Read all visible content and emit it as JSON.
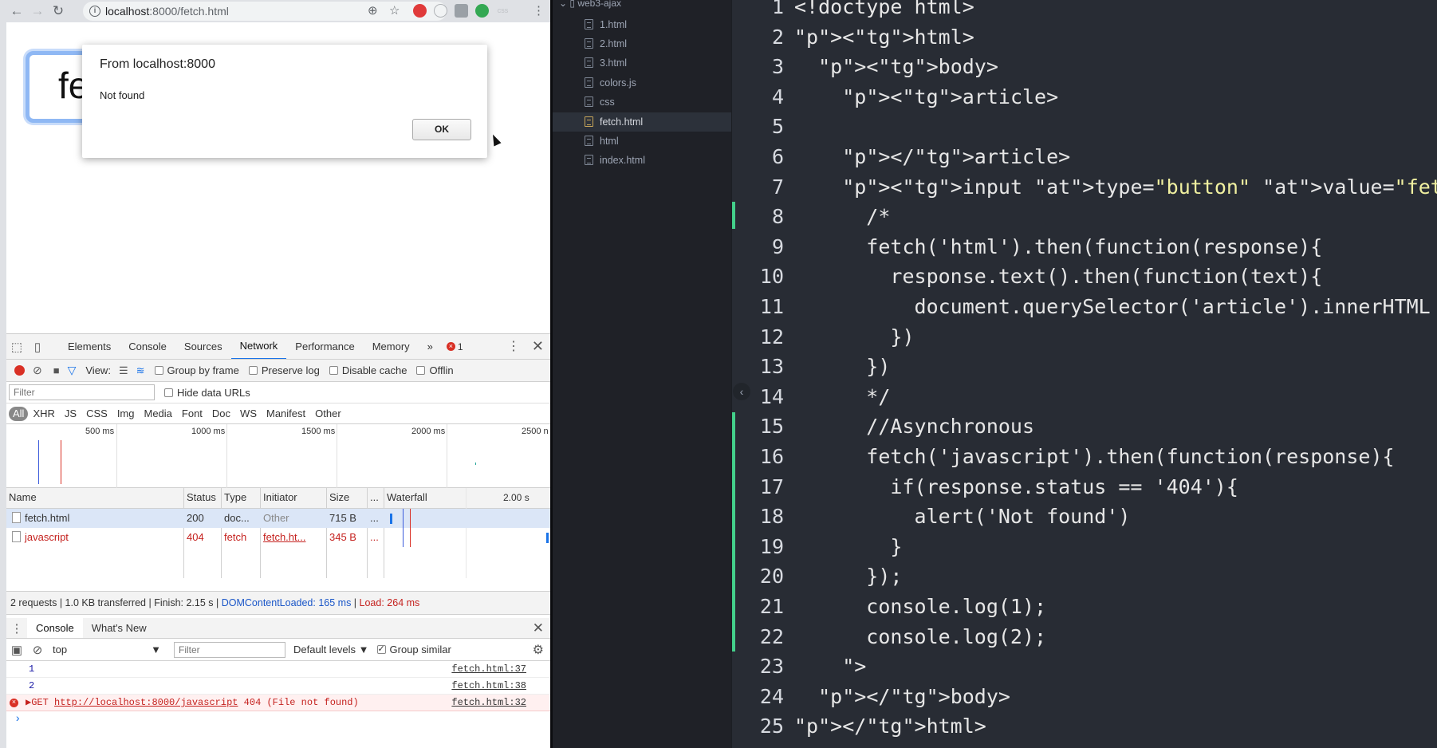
{
  "browser": {
    "url_host": "localhost",
    "url_path": ":8000/fetch.html",
    "page_button_text": "fe"
  },
  "alert": {
    "title": "From localhost:8000",
    "message": "Not found",
    "ok_label": "OK"
  },
  "devtools": {
    "tabs": [
      "Elements",
      "Console",
      "Sources",
      "Network",
      "Performance",
      "Memory"
    ],
    "active_tab": "Network",
    "overflow_label": "»",
    "error_count": "1",
    "net_toolbar": {
      "view_label": "View:",
      "group_by_frame": "Group by frame",
      "preserve_log": "Preserve log",
      "disable_cache": "Disable cache",
      "offline": "Offlin"
    },
    "filter_placeholder": "Filter",
    "hide_data_urls": "Hide data URLs",
    "type_filters": [
      "All",
      "XHR",
      "JS",
      "CSS",
      "Img",
      "Media",
      "Font",
      "Doc",
      "WS",
      "Manifest",
      "Other"
    ],
    "overview_ticks": [
      "500 ms",
      "1000 ms",
      "1500 ms",
      "2000 ms",
      "2500 n"
    ],
    "columns": {
      "name": "Name",
      "status": "Status",
      "type": "Type",
      "initiator": "Initiator",
      "size": "Size",
      "more": "...",
      "waterfall": "Waterfall",
      "scale": "2.00 s"
    },
    "requests": [
      {
        "name": "fetch.html",
        "status": "200",
        "type": "doc...",
        "initiator": "Other",
        "size": "715 B",
        "more": "..."
      },
      {
        "name": "javascript",
        "status": "404",
        "type": "fetch",
        "initiator": "fetch.ht...",
        "size": "345 B",
        "more": "..."
      }
    ],
    "summary": {
      "prefix": "2 requests | 1.0 KB transferred | Finish: 2.15 s | ",
      "dcl": "DOMContentLoaded: 165 ms",
      "sep": " | ",
      "load": "Load: 264 ms"
    },
    "drawer_tabs": [
      "Console",
      "What's New"
    ],
    "console_context": "top",
    "console_filter_placeholder": "Filter",
    "levels_label": "Default levels ▼",
    "group_similar": "Group similar",
    "console_lines": [
      {
        "text": "1",
        "source": "fetch.html:37"
      },
      {
        "text": "2",
        "source": "fetch.html:38"
      }
    ],
    "console_error": {
      "prefix": "▶GET ",
      "url": "http://localhost:8000/javascript",
      "suffix": " 404 (File not found)",
      "source": "fetch.html:32"
    },
    "prompt": "›"
  },
  "sidebar": {
    "folder": "web3-ajax",
    "files": [
      "1.html",
      "2.html",
      "3.html",
      "colors.js",
      "css",
      "fetch.html",
      "html",
      "index.html"
    ],
    "selected": "fetch.html"
  },
  "editor": {
    "line_numbers": [
      "1",
      "2",
      "3",
      "4",
      "5",
      "6",
      "7",
      "8",
      "9",
      "10",
      "11",
      "12",
      "13",
      "14",
      "15",
      "16",
      "17",
      "18",
      "19",
      "20",
      "21",
      "22",
      "23",
      "24",
      "25"
    ],
    "lines": [
      "<!doctype html>",
      "<html>",
      "  <body>",
      "    <article>",
      "",
      "    </article>",
      "    <input type=\"button\" value=\"fetch\" onclick=\"",
      "      /*",
      "      fetch('html').then(function(response){",
      "        response.text().then(function(text){",
      "          document.querySelector('article').innerHTML",
      "        })",
      "      })",
      "      */",
      "      //Asynchronous",
      "      fetch('javascript').then(function(response){",
      "        if(response.status == '404'){",
      "          alert('Not found')",
      "        }",
      "      });",
      "      console.log(1);",
      "      console.log(2);",
      "    \">",
      "  </body>",
      "</html>"
    ],
    "colors": {
      "background": "#282c34",
      "tag": "#ef596f",
      "attr": "#9ee37d",
      "string": "#f0f0a0",
      "git_added": "#43d08a"
    }
  }
}
